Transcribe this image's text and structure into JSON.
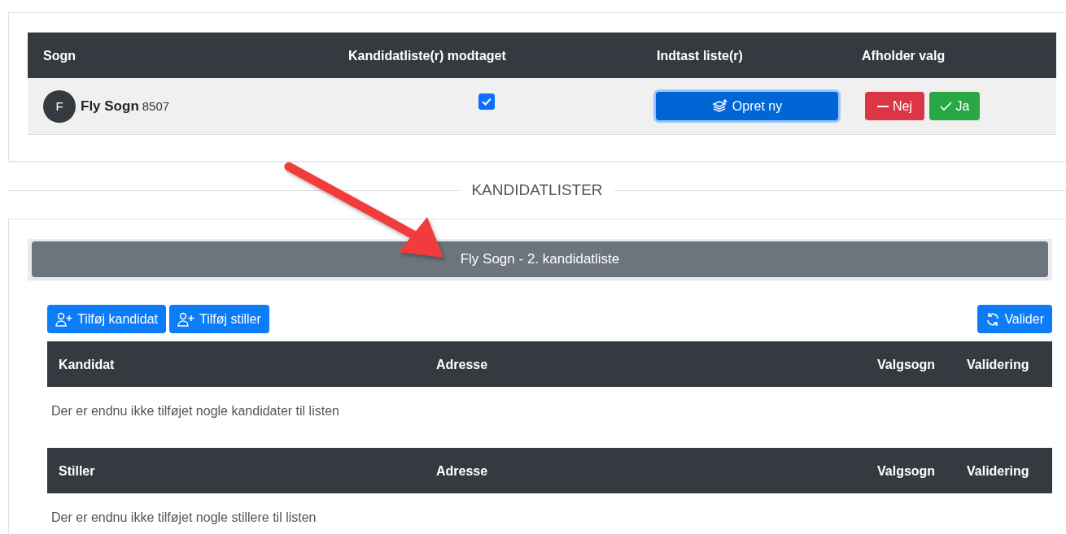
{
  "parishes_table": {
    "columns": [
      "Sogn",
      "Kandidatliste(r) modtaget",
      "Indtast liste(r)",
      "Afholder valg"
    ],
    "rows": [
      {
        "avatar": "F",
        "name": "Fly Sogn",
        "number": "8507",
        "received": true,
        "create_button": "Opret ny",
        "no_button": "Nej",
        "yes_button": "Ja"
      }
    ]
  },
  "section_title": "KANDIDATLISTER",
  "list": {
    "title": "Fly Sogn - 2. kandidatliste",
    "add_candidate": "Tilføj kandidat",
    "add_proposer": "Tilføj stiller",
    "validate": "Valider",
    "tables": [
      {
        "columns": [
          "Kandidat",
          "Adresse",
          "Valgsogn",
          "Validering"
        ],
        "empty_text": "Der er endnu ikke tilføjet nogle kandidater til listen"
      },
      {
        "columns": [
          "Stiller",
          "Adresse",
          "Valgsogn",
          "Validering"
        ],
        "empty_text": "Der er endnu ikke tilføjet nogle stillere til listen"
      }
    ]
  }
}
